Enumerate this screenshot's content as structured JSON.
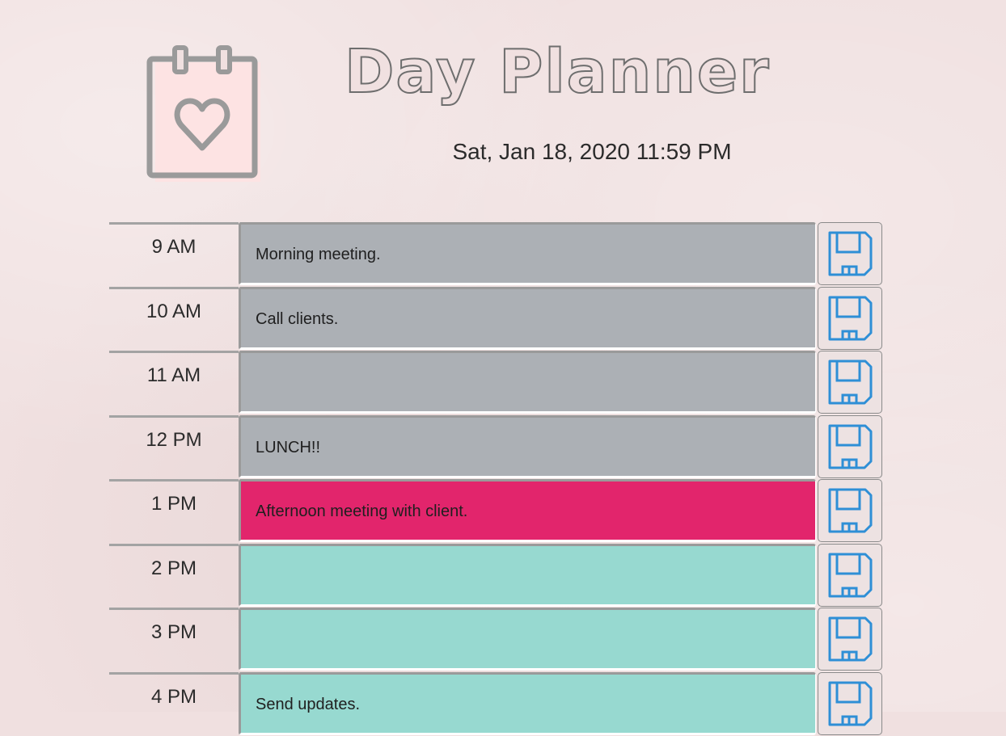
{
  "header": {
    "title": "Day Planner",
    "datetime": "Sat, Jan 18, 2020 11:59 PM",
    "logo_icon": "calendar-heart-icon"
  },
  "colors": {
    "past": "#acb0b5",
    "present": "#e2256c",
    "future": "#97d9d0",
    "save_icon": "#2e8fd6"
  },
  "rows": [
    {
      "hour": "9 AM",
      "text": "Morning meeting.",
      "state": "past"
    },
    {
      "hour": "10 AM",
      "text": "Call clients.",
      "state": "past"
    },
    {
      "hour": "11 AM",
      "text": "",
      "state": "past"
    },
    {
      "hour": "12 PM",
      "text": "LUNCH!!",
      "state": "past"
    },
    {
      "hour": "1 PM",
      "text": "Afternoon meeting with client.",
      "state": "present"
    },
    {
      "hour": "2 PM",
      "text": "",
      "state": "future"
    },
    {
      "hour": "3 PM",
      "text": "",
      "state": "future"
    },
    {
      "hour": "4 PM",
      "text": "Send updates.",
      "state": "future"
    }
  ],
  "save_button_icon": "floppy-disk-icon"
}
